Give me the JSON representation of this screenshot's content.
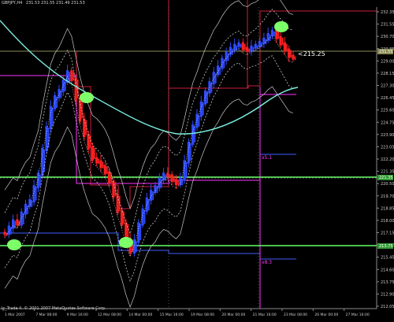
{
  "header": {
    "symbol": "GBPJPY,H4",
    "ohlc": "231.53 231.55 231.49 231.53"
  },
  "copyright": "Ic_Trade 4. © 2001-2007 MetaQuotes Software Corp.",
  "annotations": {
    "current_price_label": "<215.25",
    "level_x1": "x5.1",
    "level_x2": "x8.3"
  },
  "colors": {
    "background": "#000000",
    "bull": "#2f4bff",
    "bear": "#ff2020",
    "envelope": "#c8c8c8",
    "ma": "#7cf0e0",
    "box_red": "#cc1f3c",
    "magenta": "#ff33ff",
    "blue_level": "#3f5bff",
    "green_level": "#66ff66",
    "marker": "#7dff6a",
    "axis": "#8c8c8c"
  },
  "chart_data": {
    "type": "candlestick",
    "symbol": "GBPJPY",
    "timeframe": "H4",
    "price_axis_ticks": [
      "232.35",
      "231.55",
      "230.70",
      "229.85",
      "229.00",
      "228.15",
      "227.30",
      "226.45",
      "225.60",
      "224.75",
      "223.90",
      "223.05",
      "222.20",
      "221.35",
      "220.50",
      "219.70",
      "218.85",
      "218.00",
      "217.15",
      "216.30",
      "215.45",
      "214.60",
      "213.75",
      "212.90",
      "212.05"
    ],
    "time_axis_labels": [
      "1 Mar 2007",
      "7 Mar 08:00",
      "9 Mar 16:00",
      "12 Mar 08:00",
      "14 Mar 00:00",
      "15 Mar 16:00",
      "19 Mar 08:00",
      "20 Mar 00:00",
      "21 Mar 16:00",
      "23 Mar 08:00",
      "26 Mar 00:00",
      "27 Mar 16:00"
    ],
    "highlighted_prices": [
      "231.55",
      "221.35",
      "213.75"
    ],
    "trend": [
      218.8,
      219.2,
      219.6,
      219.4,
      220.1,
      220.6,
      220.9,
      221.8,
      222.6,
      224.2,
      225.6,
      226.9,
      227.6,
      228.0,
      228.6,
      229.2,
      228.7,
      227.4,
      226.1,
      225.1,
      224.3,
      223.6,
      223.4,
      223.1,
      222.7,
      222.1,
      221.2,
      220.2,
      219.4,
      218.4,
      217.6,
      218.3,
      219.4,
      220.3,
      221.0,
      221.5,
      221.8,
      222.3,
      222.6,
      222.5,
      222.2,
      222.0,
      222.3,
      223.4,
      224.6,
      225.7,
      226.4,
      227.2,
      227.9,
      228.5,
      229.1,
      229.5,
      230.0,
      230.4,
      230.7,
      230.9,
      231.0,
      230.7,
      230.6,
      230.8,
      230.9,
      231.1,
      231.3,
      231.6,
      231.8,
      231.4,
      231.0,
      230.6,
      230.2,
      230.1
    ]
  }
}
